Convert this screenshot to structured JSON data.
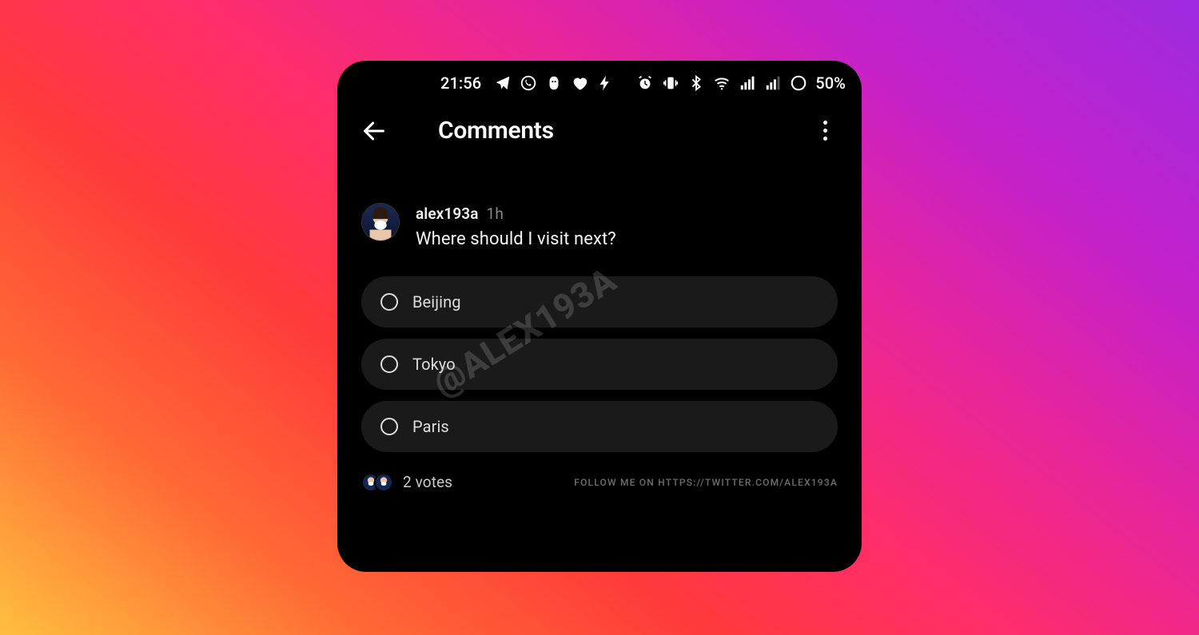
{
  "statusbar": {
    "time": "21:56",
    "battery_text": "50%",
    "icons": [
      "telegram",
      "whatsapp",
      "duolingo",
      "heart",
      "bolt",
      "alarm",
      "vibrate",
      "bluetooth",
      "wifi",
      "signal1",
      "signal2",
      "data-circle"
    ]
  },
  "header": {
    "title": "Comments"
  },
  "post": {
    "username": "alex193a",
    "time": "1h",
    "question": "Where should I visit next?"
  },
  "poll": {
    "options": [
      "Beijing",
      "Tokyo",
      "Paris"
    ],
    "votes_label": "2 votes"
  },
  "footer": {
    "follow_text": "FOLLOW ME ON HTTPS://TWITTER.COM/ALEX193A"
  },
  "watermark": "@ALEX193A"
}
